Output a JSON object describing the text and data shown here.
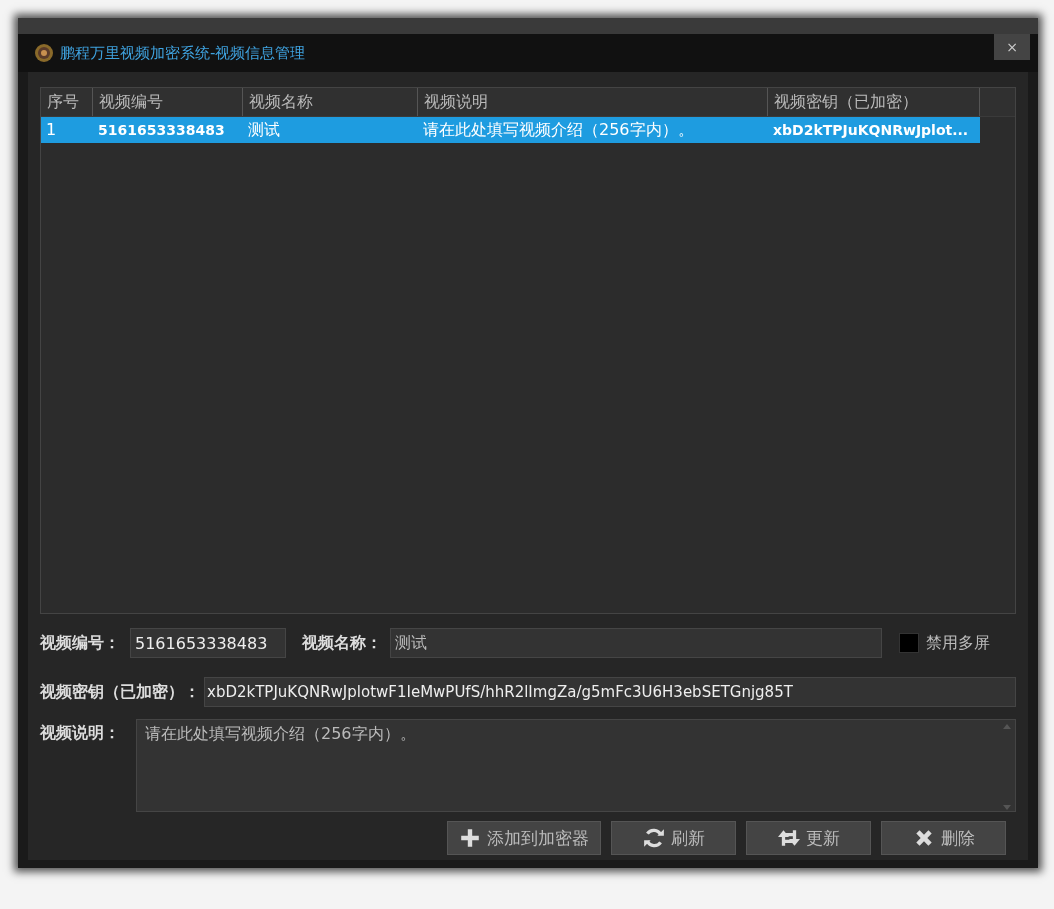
{
  "window": {
    "title": "鹏程万里视频加密系统-视频信息管理",
    "close": "×"
  },
  "table": {
    "columns": [
      "序号",
      "视频编号",
      "视频名称",
      "视频说明",
      "视频密钥（已加密）"
    ],
    "rows": [
      {
        "cells": [
          "1",
          "5161653338483",
          "测试",
          "请在此处填写视频介绍（256字内）。",
          "xbD2kTPJuKQNRwJplot..."
        ],
        "selected": true
      }
    ]
  },
  "form": {
    "id": {
      "label": "视频编号：",
      "value": "5161653338483"
    },
    "name": {
      "label": "视频名称：",
      "value": "测试"
    },
    "disable_multiscreen": {
      "label": "禁用多屏",
      "checked": false
    },
    "key": {
      "label": "视频密钥（已加密）：",
      "value": "xbD2kTPJuKQNRwJplotwF1IeMwPUfS/hhR2lImgZa/g5mFc3U6H3ebSETGnjg85T"
    },
    "description": {
      "label": "视频说明：",
      "value": "请在此处填写视频介绍（256字内）。"
    }
  },
  "buttons": [
    {
      "kind": "add",
      "label": "添加到加密器"
    },
    {
      "kind": "refresh",
      "label": "刷新"
    },
    {
      "kind": "update",
      "label": "更新"
    },
    {
      "kind": "delete",
      "label": "删除"
    }
  ]
}
